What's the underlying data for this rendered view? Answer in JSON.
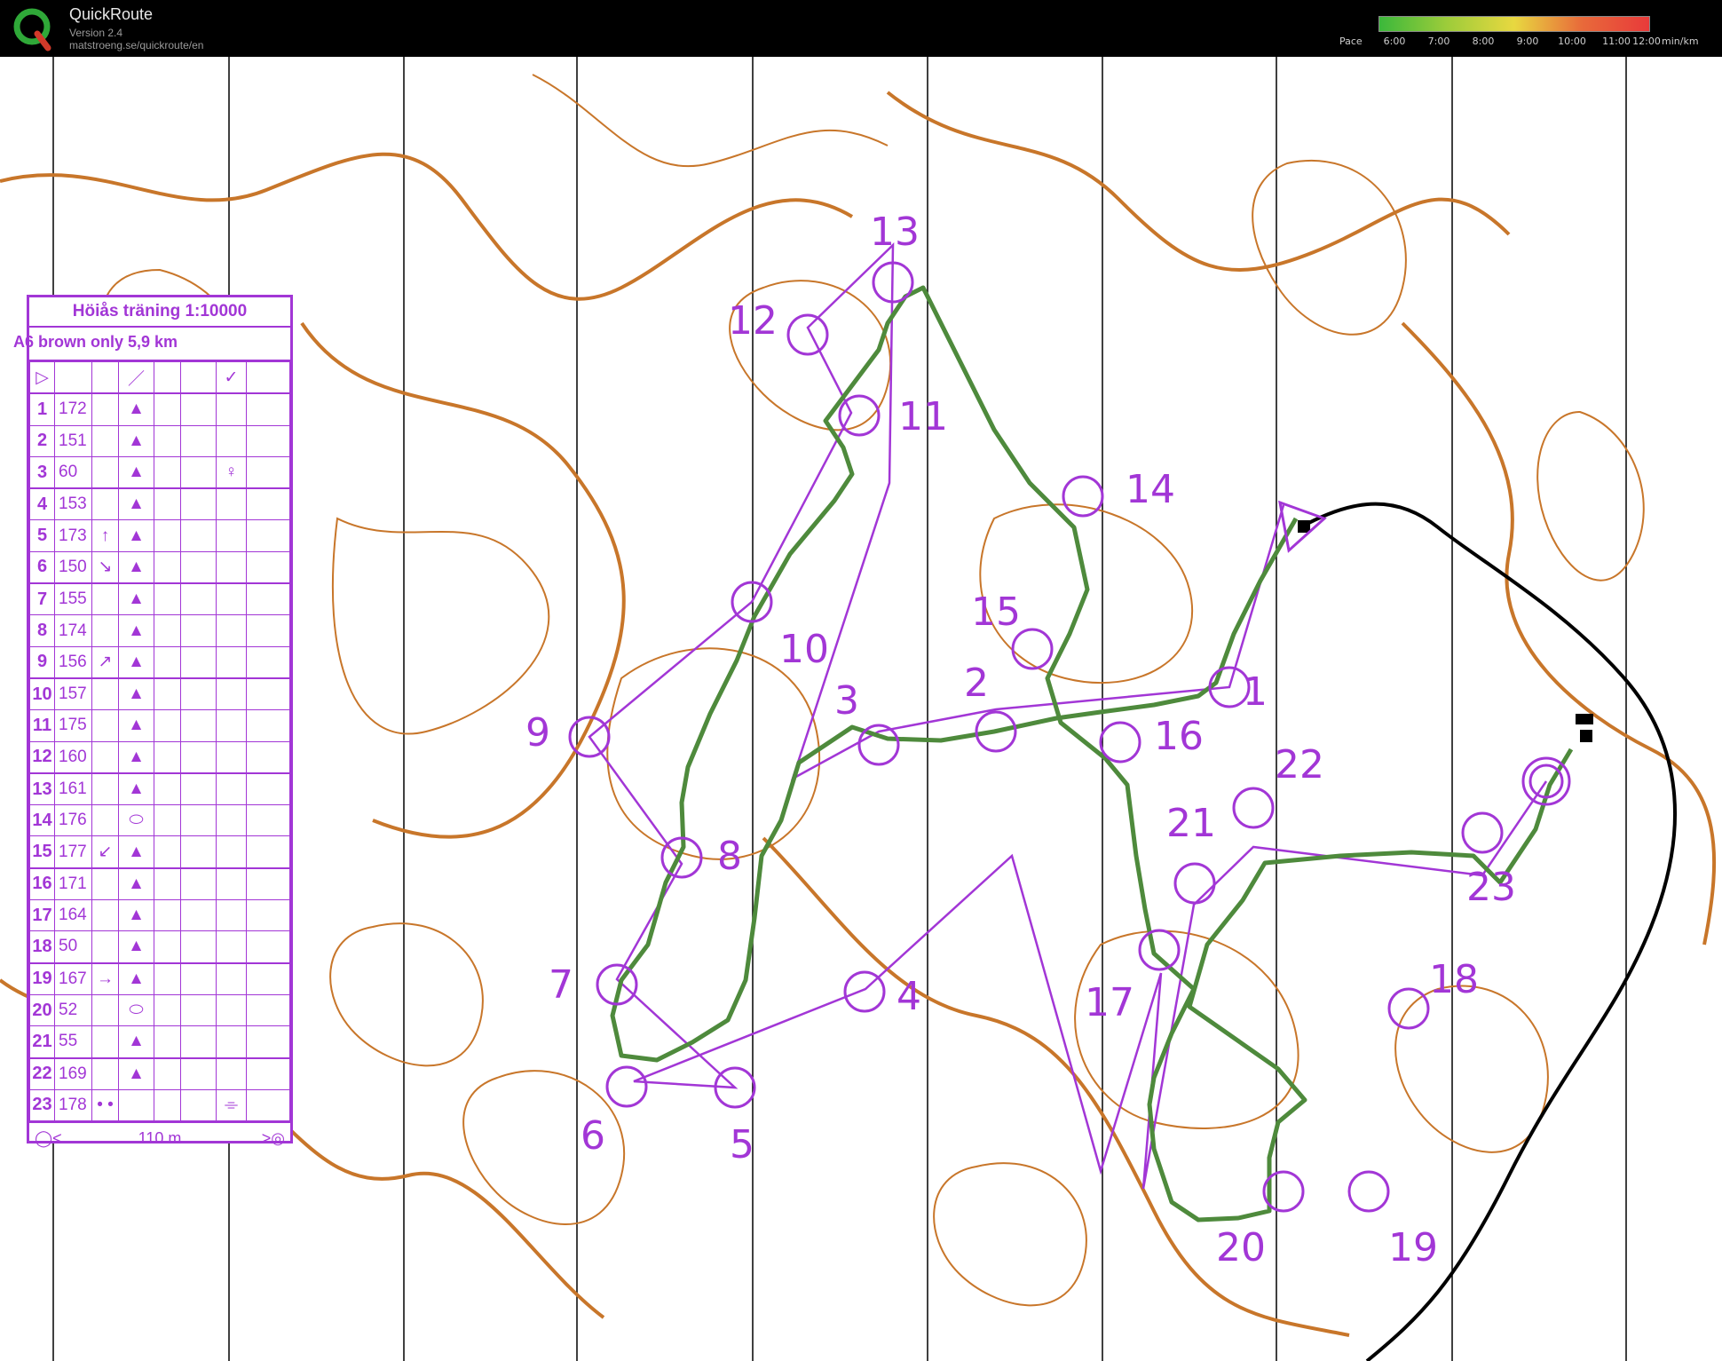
{
  "app": {
    "title": "QuickRoute",
    "version": "Version 2.4",
    "url": "matstroeng.se/quickroute/en",
    "logo_icon": "quickroute-logo-icon"
  },
  "pace_scale": {
    "label": "Pace",
    "ticks": [
      "6:00",
      "7:00",
      "8:00",
      "9:00",
      "10:00",
      "11:00",
      "12:00"
    ],
    "unit": "min/km",
    "colors": [
      "#3bb83b",
      "#9dcc3a",
      "#e8d840",
      "#e86a3a",
      "#e83a3a"
    ]
  },
  "course": {
    "title": "Höiås träning 1:10000",
    "subtitle": "A6 brown only  5,9 km",
    "finish_distance": "110 m",
    "colors": {
      "course": "#a236d6",
      "route": "#4e8a3c",
      "contours": "#c8762a",
      "track": "#000000"
    },
    "controls": [
      {
        "seq": "1",
        "code": "172",
        "dir": "",
        "feature": "▲",
        "extra": ""
      },
      {
        "seq": "2",
        "code": "151",
        "dir": "",
        "feature": "▲",
        "extra": ""
      },
      {
        "seq": "3",
        "code": "60",
        "dir": "",
        "feature": "▲",
        "extra": "♀"
      },
      {
        "seq": "4",
        "code": "153",
        "dir": "",
        "feature": "▲",
        "extra": ""
      },
      {
        "seq": "5",
        "code": "173",
        "dir": "↑",
        "feature": "▲",
        "extra": ""
      },
      {
        "seq": "6",
        "code": "150",
        "dir": "↘",
        "feature": "▲",
        "extra": ""
      },
      {
        "seq": "7",
        "code": "155",
        "dir": "",
        "feature": "▲",
        "extra": ""
      },
      {
        "seq": "8",
        "code": "174",
        "dir": "",
        "feature": "▲",
        "extra": ""
      },
      {
        "seq": "9",
        "code": "156",
        "dir": "↗",
        "feature": "▲",
        "extra": ""
      },
      {
        "seq": "10",
        "code": "157",
        "dir": "",
        "feature": "▲",
        "extra": ""
      },
      {
        "seq": "11",
        "code": "175",
        "dir": "",
        "feature": "▲",
        "extra": ""
      },
      {
        "seq": "12",
        "code": "160",
        "dir": "",
        "feature": "▲",
        "extra": ""
      },
      {
        "seq": "13",
        "code": "161",
        "dir": "",
        "feature": "▲",
        "extra": ""
      },
      {
        "seq": "14",
        "code": "176",
        "dir": "",
        "feature": "⬭",
        "extra": ""
      },
      {
        "seq": "15",
        "code": "177",
        "dir": "↙",
        "feature": "▲",
        "extra": ""
      },
      {
        "seq": "16",
        "code": "171",
        "dir": "",
        "feature": "▲",
        "extra": ""
      },
      {
        "seq": "17",
        "code": "164",
        "dir": "",
        "feature": "▲",
        "extra": ""
      },
      {
        "seq": "18",
        "code": "50",
        "dir": "",
        "feature": "▲",
        "extra": ""
      },
      {
        "seq": "19",
        "code": "167",
        "dir": "→",
        "feature": "▲",
        "extra": ""
      },
      {
        "seq": "20",
        "code": "52",
        "dir": "",
        "feature": "⬭",
        "extra": ""
      },
      {
        "seq": "21",
        "code": "55",
        "dir": "",
        "feature": "▲",
        "extra": ""
      },
      {
        "seq": "22",
        "code": "169",
        "dir": "",
        "feature": "▲",
        "extra": ""
      },
      {
        "seq": "23",
        "code": "178",
        "dir": "• •",
        "feature": "",
        "extra": "⌯"
      }
    ],
    "map_labels": [
      "1",
      "2",
      "3",
      "4",
      "5",
      "6",
      "7",
      "8",
      "9",
      "10",
      "11",
      "12",
      "13",
      "14",
      "15",
      "16",
      "17",
      "18",
      "19",
      "20",
      "21",
      "22",
      "23"
    ]
  }
}
